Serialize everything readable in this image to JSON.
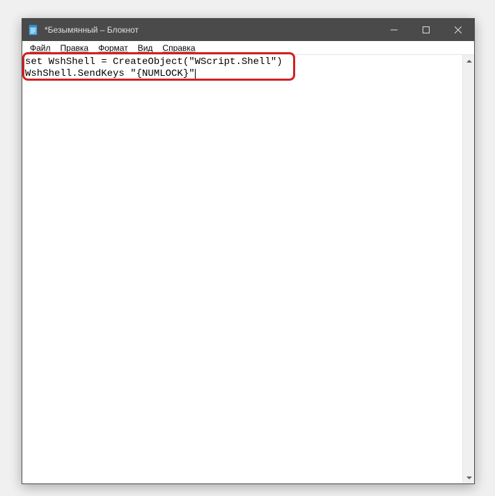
{
  "titlebar": {
    "title": "*Безымянный – Блокнот"
  },
  "menubar": {
    "file": "Файл",
    "edit": "Правка",
    "format": "Формат",
    "view": "Вид",
    "help": "Справка"
  },
  "editor": {
    "line1": "set WshShell = CreateObject(\"WScript.Shell\")",
    "line2": "WshShell.SendKeys \"{NUMLOCK}\""
  }
}
